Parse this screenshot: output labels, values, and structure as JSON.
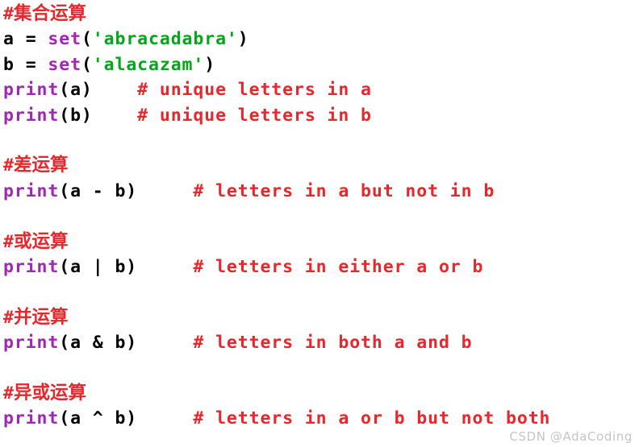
{
  "document": {
    "title": "Python set operations code snippet",
    "language": "python",
    "background_color": "#ffffff"
  },
  "colors": {
    "comment": "#e8272c",
    "heading": "#e8272c",
    "plain": "#000000",
    "function": "#a026b5",
    "string": "#00a619",
    "watermark": "#969696"
  },
  "lines": [
    {
      "index": 1,
      "type": "heading",
      "hash": "#",
      "text": "集合运算",
      "full": "#集合运算"
    },
    {
      "index": 2,
      "type": "code",
      "full": "a = set('abracadabra')",
      "tokens": [
        {
          "t": "a = ",
          "c": "plain"
        },
        {
          "t": "set",
          "c": "func"
        },
        {
          "t": "(",
          "c": "punct"
        },
        {
          "t": "'abracadabra'",
          "c": "string"
        },
        {
          "t": ")",
          "c": "punct"
        }
      ]
    },
    {
      "index": 3,
      "type": "code",
      "full": "b = set('alacazam')",
      "tokens": [
        {
          "t": "b = ",
          "c": "plain"
        },
        {
          "t": "set",
          "c": "func"
        },
        {
          "t": "(",
          "c": "punct"
        },
        {
          "t": "'alacazam'",
          "c": "string"
        },
        {
          "t": ")",
          "c": "punct"
        }
      ]
    },
    {
      "index": 4,
      "type": "code",
      "full": "print(a)    # unique letters in a",
      "tokens": [
        {
          "t": "print",
          "c": "func"
        },
        {
          "t": "(a)    ",
          "c": "plain"
        },
        {
          "t": "# unique letters in a",
          "c": "comment"
        }
      ]
    },
    {
      "index": 5,
      "type": "code",
      "full": "print(b)    # unique letters in b",
      "tokens": [
        {
          "t": "print",
          "c": "func"
        },
        {
          "t": "(b)    ",
          "c": "plain"
        },
        {
          "t": "# unique letters in b",
          "c": "comment"
        }
      ]
    },
    {
      "index": 6,
      "type": "blank",
      "full": ""
    },
    {
      "index": 7,
      "type": "heading",
      "hash": "#",
      "text": "差运算",
      "full": "#差运算"
    },
    {
      "index": 8,
      "type": "code",
      "full": "print(a - b)     # letters in a but not in b",
      "tokens": [
        {
          "t": "print",
          "c": "func"
        },
        {
          "t": "(a - b)     ",
          "c": "plain"
        },
        {
          "t": "# letters in a but not in b",
          "c": "comment"
        }
      ]
    },
    {
      "index": 9,
      "type": "blank",
      "full": ""
    },
    {
      "index": 10,
      "type": "heading",
      "hash": "#",
      "text": "或运算",
      "full": "#或运算"
    },
    {
      "index": 11,
      "type": "code",
      "full": "print(a | b)     # letters in either a or b",
      "tokens": [
        {
          "t": "print",
          "c": "func"
        },
        {
          "t": "(a | b)     ",
          "c": "plain"
        },
        {
          "t": "# letters in either a or b",
          "c": "comment"
        }
      ]
    },
    {
      "index": 12,
      "type": "blank",
      "full": ""
    },
    {
      "index": 13,
      "type": "heading",
      "hash": "#",
      "text": "并运算",
      "full": "#并运算"
    },
    {
      "index": 14,
      "type": "code",
      "full": "print(a & b)     # letters in both a and b",
      "tokens": [
        {
          "t": "print",
          "c": "func"
        },
        {
          "t": "(a & b)     ",
          "c": "plain"
        },
        {
          "t": "# letters in both a and b",
          "c": "comment"
        }
      ]
    },
    {
      "index": 15,
      "type": "blank",
      "full": ""
    },
    {
      "index": 16,
      "type": "heading",
      "hash": "#",
      "text": "异或运算",
      "full": "#异或运算"
    },
    {
      "index": 17,
      "type": "code",
      "full": "print(a ^ b)     # letters in a or b but not both",
      "tokens": [
        {
          "t": "print",
          "c": "func"
        },
        {
          "t": "(a ^ b)     ",
          "c": "plain"
        },
        {
          "t": "# letters in a or b but not both",
          "c": "comment"
        }
      ]
    }
  ],
  "watermark": {
    "text": "CSDN @AdaCoding"
  }
}
